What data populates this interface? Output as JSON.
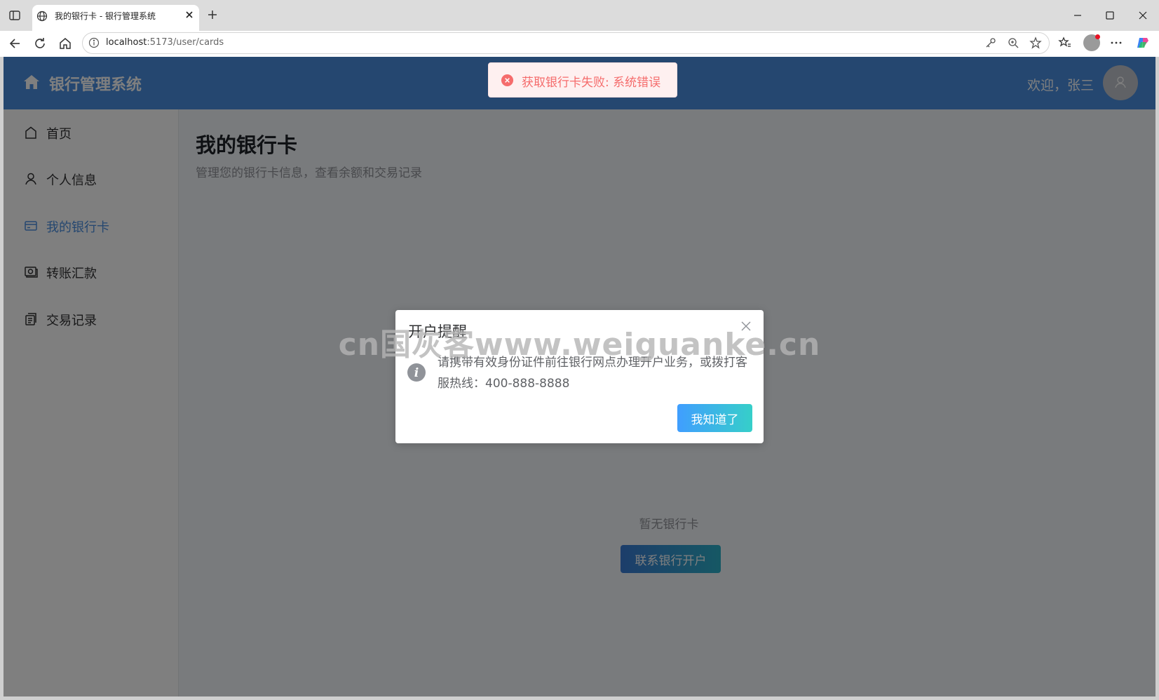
{
  "browser": {
    "tab_title": "我的银行卡 - 银行管理系统",
    "url_host": "localhost",
    "url_path": ":5173/user/cards"
  },
  "header": {
    "title": "银行管理系统",
    "welcome": "欢迎，张三"
  },
  "toast": {
    "message": "获取银行卡失败: 系统错误",
    "color": "#f56c6c"
  },
  "sidebar": {
    "items": [
      {
        "label": "首页",
        "icon": "home-icon"
      },
      {
        "label": "个人信息",
        "icon": "user-icon"
      },
      {
        "label": "我的银行卡",
        "icon": "credit-card-icon",
        "active": true
      },
      {
        "label": "转账汇款",
        "icon": "transfer-icon"
      },
      {
        "label": "交易记录",
        "icon": "document-icon"
      }
    ]
  },
  "main": {
    "title": "我的银行卡",
    "subtitle": "管理您的银行卡信息，查看余额和交易记录",
    "empty_text": "暂无银行卡",
    "contact_button": "联系银行开户"
  },
  "dialog": {
    "title": "开户提醒",
    "message": "请携带有效身份证件前往银行网点办理开户业务，或拨打客服热线：400-888-8888",
    "ok_button": "我知道了"
  },
  "watermark": "cn国灰客www.weiguanke.cn",
  "colors": {
    "primary": "#4a8fe0",
    "error": "#f56c6c"
  }
}
